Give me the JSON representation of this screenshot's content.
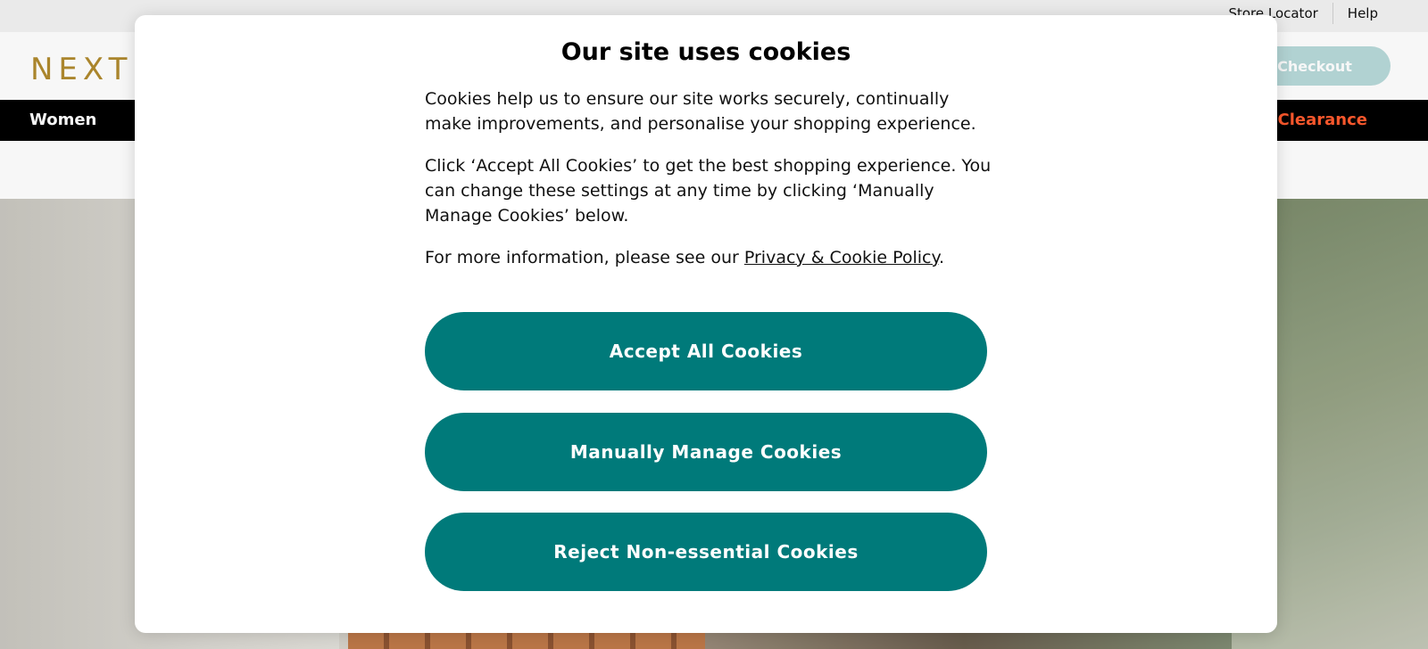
{
  "utility": {
    "store_locator": "Store Locator",
    "help": "Help"
  },
  "header": {
    "logo": "NEXT",
    "checkout_label": "Checkout"
  },
  "nav": {
    "women": "Women",
    "clearance": "Clearance"
  },
  "cookie_modal": {
    "title": "Our site uses cookies",
    "paragraph_1": "Cookies help us to ensure our site works securely, continually make improvements, and personalise your shopping experience.",
    "paragraph_2": "Click ‘Accept All Cookies’ to get the best shopping experience. You can change these settings at any time by clicking ‘Manually Manage Cookies’ below.",
    "paragraph_3_prefix": "For more information, please see our ",
    "policy_link": "Privacy & Cookie Policy",
    "paragraph_3_suffix": ".",
    "accept_label": "Accept All Cookies",
    "manage_label": "Manually Manage Cookies",
    "reject_label": "Reject Non-essential Cookies"
  },
  "colors": {
    "brand_gold": "#b08a2e",
    "button_teal": "#007a7a",
    "clearance_orange": "#ff5a2e",
    "checkout_disabled": "#b7d9d9"
  }
}
